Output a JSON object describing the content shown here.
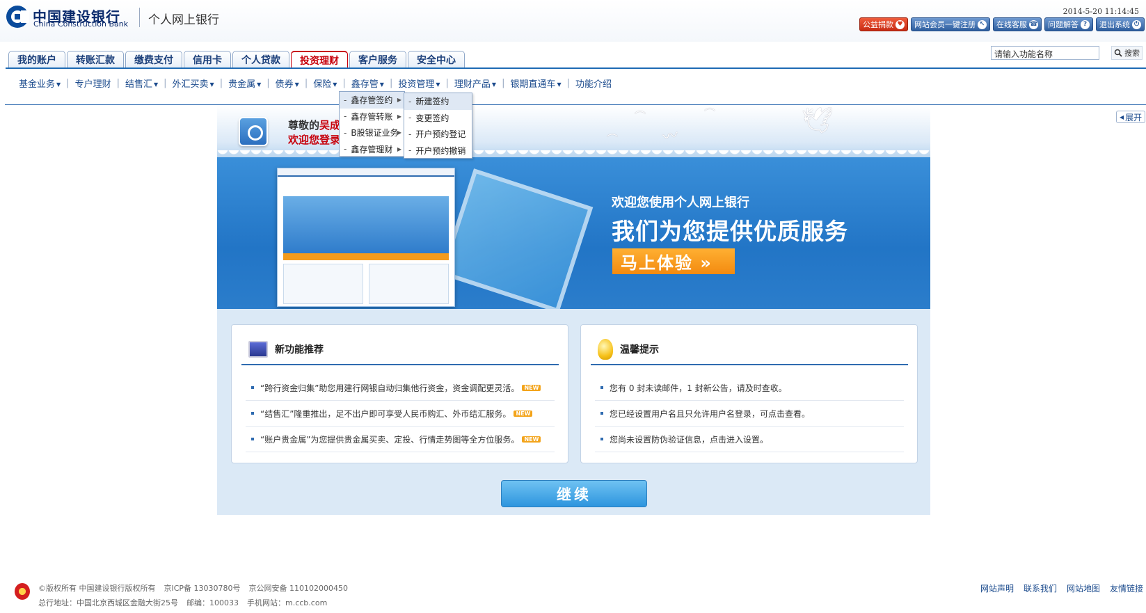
{
  "header": {
    "bank_name_cn": "中国建设银行",
    "bank_name_en": "China Construction Bank",
    "subtitle": "个人网上银行",
    "datetime": "2014-5-20 11:14:45",
    "links": [
      {
        "label": "公益捐款",
        "icon": "heart-icon"
      },
      {
        "label": "网站会员一键注册",
        "icon": "cursor-icon"
      },
      {
        "label": "在线客服",
        "icon": "headset-icon"
      },
      {
        "label": "问题解答",
        "icon": "question-icon"
      },
      {
        "label": "退出系统",
        "icon": "power-icon"
      }
    ]
  },
  "tabs": [
    {
      "label": "我的账户"
    },
    {
      "label": "转账汇款"
    },
    {
      "label": "缴费支付"
    },
    {
      "label": "信用卡"
    },
    {
      "label": "个人贷款"
    },
    {
      "label": "投资理财",
      "active": true
    },
    {
      "label": "客户服务"
    },
    {
      "label": "安全中心"
    }
  ],
  "search": {
    "value": "请输入功能名称",
    "button_label": "搜索"
  },
  "subnav": [
    {
      "label": "基金业务",
      "arrow": true
    },
    {
      "label": "专户理财",
      "arrow": false
    },
    {
      "label": "结售汇",
      "arrow": true
    },
    {
      "label": "外汇买卖",
      "arrow": true
    },
    {
      "label": "贵金属",
      "arrow": true
    },
    {
      "label": "债券",
      "arrow": true
    },
    {
      "label": "保险",
      "arrow": true
    },
    {
      "label": "鑫存管",
      "arrow": true
    },
    {
      "label": "投资管理",
      "arrow": true
    },
    {
      "label": "理财产品",
      "arrow": true
    },
    {
      "label": "银期直通车",
      "arrow": true
    },
    {
      "label": "功能介绍",
      "arrow": false
    }
  ],
  "dropdown": {
    "level1": [
      "鑫存管签约",
      "鑫存管转账",
      "B股银证业务",
      "鑫存管理财"
    ],
    "level2": [
      "新建签约",
      "变更签约",
      "开户预约登记",
      "开户预约撤销"
    ]
  },
  "greeting": {
    "line1_prefix": "尊敬的",
    "line1_name": "吴成",
    "line2": "欢迎您登录"
  },
  "banner": {
    "small": "欢迎您使用个人网上银行",
    "big": "我们为您提供优质服务",
    "button": "马上体验 »"
  },
  "expand_label": "展开",
  "new_features": {
    "title": "新功能推荐",
    "items": [
      "“跨行资金归集”助您用建行网银自动归集他行资金，资金调配更灵活。",
      "“结售汇”隆重推出，足不出户即可享受人民币购汇、外币结汇服务。",
      "“账户贵金属”为您提供贵金属买卖、定投、行情走势图等全方位服务。"
    ],
    "new_badge": "NEW"
  },
  "tips": {
    "title": "温馨提示",
    "items": [
      "您有 0 封未读邮件，1 封新公告，请及时查收。",
      "您已经设置用户名且只允许用户名登录，可点击查看。",
      "您尚未设置防伪验证信息，点击进入设置。"
    ]
  },
  "continue_label": "继续",
  "footer": {
    "line1": [
      "©版权所有 中国建设银行版权所有",
      "京ICP备 13030780号",
      "京公网安备 110102000450"
    ],
    "line2": [
      "总行地址：中国北京西城区金融大街25号",
      "邮编：100033",
      "手机网站：m.ccb.com"
    ],
    "links": [
      "网站声明",
      "联系我们",
      "网站地图",
      "友情链接"
    ]
  }
}
